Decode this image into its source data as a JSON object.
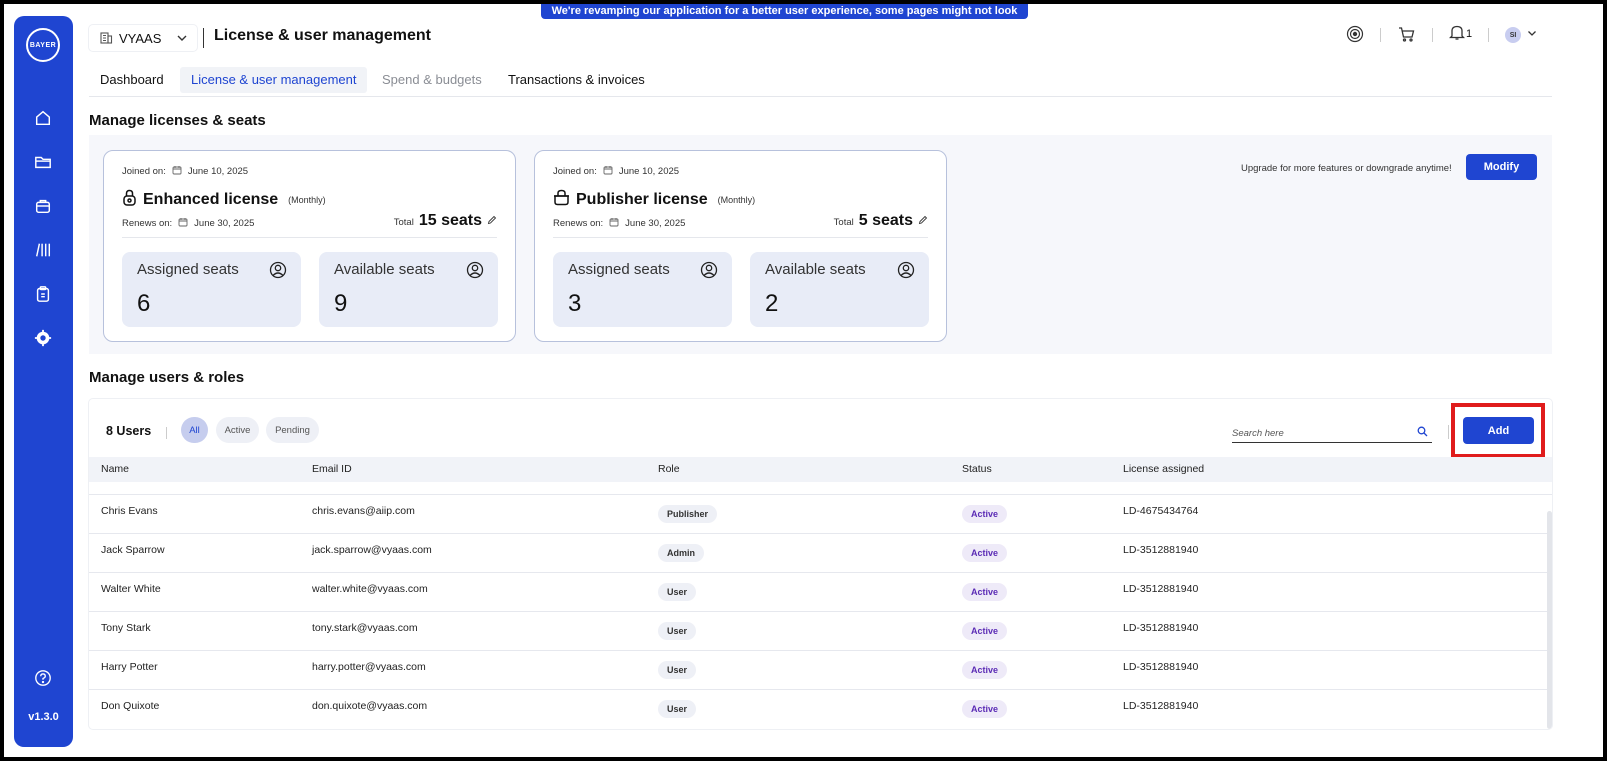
{
  "banner": "We're revamping our application for a better user experience, some pages might not look perfect yet!",
  "sidebar": {
    "logo": "BAYER",
    "version": "v1.3.0"
  },
  "header": {
    "org": "VYAAS",
    "title": "License & user management",
    "notifications_count": "1",
    "avatar_initials": "SI"
  },
  "tabs": [
    {
      "label": "Dashboard"
    },
    {
      "label": "License & user management"
    },
    {
      "label": "Spend & budgets"
    },
    {
      "label": "Transactions & invoices"
    }
  ],
  "licenses_section": {
    "title": "Manage licenses & seats",
    "upgrade_text": "Upgrade for more features or downgrade anytime!",
    "modify_label": "Modify",
    "cards": [
      {
        "joined_label": "Joined on:",
        "joined_date": "June 10, 2025",
        "name": "Enhanced license",
        "period": "(Monthly)",
        "renews_label": "Renews on:",
        "renews_date": "June 30, 2025",
        "total_label": "Total",
        "total_value": "15 seats",
        "assigned_label": "Assigned seats",
        "assigned_value": "6",
        "available_label": "Available seats",
        "available_value": "9"
      },
      {
        "joined_label": "Joined on:",
        "joined_date": "June 10, 2025",
        "name": "Publisher license",
        "period": "(Monthly)",
        "renews_label": "Renews on:",
        "renews_date": "June 30, 2025",
        "total_label": "Total",
        "total_value": "5 seats",
        "assigned_label": "Assigned seats",
        "assigned_value": "3",
        "available_label": "Available seats",
        "available_value": "2"
      }
    ]
  },
  "users_section": {
    "title": "Manage users & roles",
    "count": "8 Users",
    "filters": [
      "All",
      "Active",
      "Pending"
    ],
    "search_placeholder": "Search here",
    "add_label": "Add",
    "columns": [
      "Name",
      "Email ID",
      "Role",
      "Status",
      "License assigned"
    ],
    "rows": [
      {
        "name": "Chris Evans",
        "email": "chris.evans@aiip.com",
        "role": "Publisher",
        "status": "Active",
        "license": "LD-4675434764"
      },
      {
        "name": "Jack Sparrow",
        "email": "jack.sparrow@vyaas.com",
        "role": "Admin",
        "status": "Active",
        "license": "LD-3512881940"
      },
      {
        "name": "Walter White",
        "email": "walter.white@vyaas.com",
        "role": "User",
        "status": "Active",
        "license": "LD-3512881940"
      },
      {
        "name": "Tony Stark",
        "email": "tony.stark@vyaas.com",
        "role": "User",
        "status": "Active",
        "license": "LD-3512881940"
      },
      {
        "name": "Harry Potter",
        "email": "harry.potter@vyaas.com",
        "role": "User",
        "status": "Active",
        "license": "LD-3512881940"
      },
      {
        "name": "Don Quixote",
        "email": "don.quixote@vyaas.com",
        "role": "User",
        "status": "Active",
        "license": "LD-3512881940"
      }
    ]
  },
  "colors": {
    "brand": "#1f45d1",
    "highlight": "#e01c1c",
    "status_text": "#5b2bb5"
  }
}
